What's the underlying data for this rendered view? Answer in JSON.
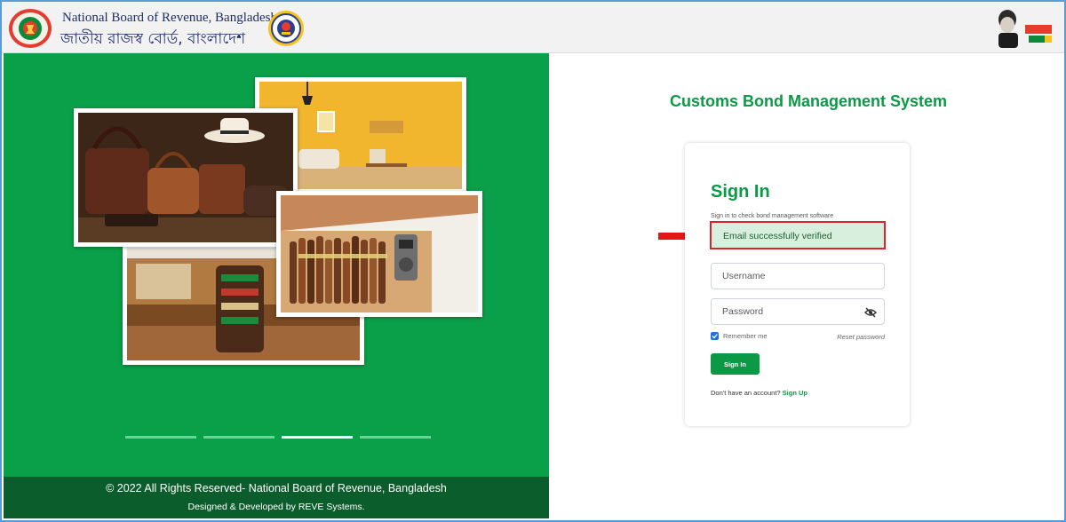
{
  "header": {
    "org_name_en": "National Board of Revenue, Bangladesh",
    "org_name_bn": "জাতীয় রাজস্ব বোর্ড, বাংলাদেশ",
    "logo_nbr_icon": "nbr-emblem-icon",
    "logo_customs_icon": "bangladesh-customs-emblem-icon",
    "logo_mujib_icon": "mujib-100-logo-icon"
  },
  "left_panel": {
    "photos": [
      "leather-goods-photo",
      "living-room-photo",
      "duty-free-store-photo",
      "cigar-humidor-photo"
    ],
    "carousel": {
      "slides": 4,
      "active_index": 2
    },
    "footer": {
      "copyright": "© 2022 All Rights Reserved- National Board of Revenue, Bangladesh",
      "credit": "Designed & Developed by REVE Systems."
    }
  },
  "main": {
    "system_title": "Customs Bond Management System"
  },
  "signin": {
    "title": "Sign In",
    "subtitle": "Sign in to check bond management software",
    "alert": "Email successfully verified",
    "username_placeholder": "Username",
    "password_placeholder": "Password",
    "remember_label": "Remember me",
    "remember_checked": true,
    "reset_link": "Reset password",
    "submit_label": "Sign In",
    "signup_prompt": "Don't have an account?",
    "signup_link": "Sign Up"
  },
  "colors": {
    "brand_green": "#0aa04a",
    "footer_green": "#0b5e2c",
    "accent_red": "#d9232e",
    "alert_bg": "#d9efdd"
  }
}
